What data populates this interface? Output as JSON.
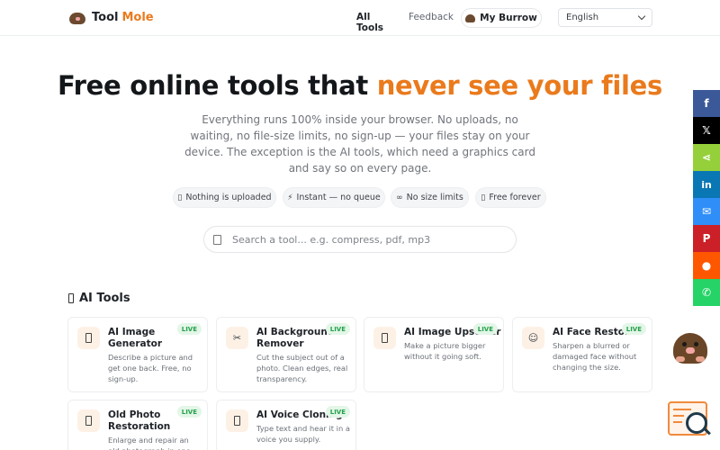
{
  "header": {
    "logo_word1": "Tool",
    "logo_word2": "Mole",
    "nav_all_tools": "All Tools",
    "nav_feedback": "Feedback",
    "burrow_label": "My Burrow",
    "language": "English"
  },
  "hero": {
    "title_main": "Free online tools that ",
    "title_accent": "never see your files",
    "subtitle": "Everything runs 100% inside your browser. No uploads, no waiting, no file-size limits, no sign-up — your files stay on your device. The exception is the AI tools, which need a graphics card and say so on every page.",
    "pills": [
      {
        "icon": "▯",
        "label": "Nothing is uploaded"
      },
      {
        "icon": "⚡",
        "label": "Instant — no queue"
      },
      {
        "icon": "∞",
        "label": "No size limits"
      },
      {
        "icon": "▯",
        "label": "Free forever"
      }
    ]
  },
  "search": {
    "placeholder": "Search a tool... e.g. compress, pdf, mp3"
  },
  "section": {
    "title": "AI Tools"
  },
  "cards": [
    {
      "title": "AI Image Generator",
      "desc": "Describe a picture and get one back. Free, no sign-up.",
      "badge": "LIVE",
      "icon": "▯"
    },
    {
      "title": "AI Background Remover",
      "desc": "Cut the subject out of a photo. Clean edges, real transparency.",
      "badge": "LIVE",
      "icon": "✂"
    },
    {
      "title": "AI Image Upscaler",
      "desc": "Make a picture bigger without it going soft.",
      "badge": "LIVE",
      "icon": "▯"
    },
    {
      "title": "AI Face Restorer",
      "desc": "Sharpen a blurred or damaged face without changing the size.",
      "badge": "LIVE",
      "icon": "☺"
    },
    {
      "title": "Old Photo Restoration",
      "desc": "Enlarge and repair an old photograph in one",
      "badge": "LIVE",
      "icon": "▯"
    },
    {
      "title": "AI Voice Cloning",
      "desc": "Type text and hear it in a voice you supply.",
      "badge": "LIVE",
      "icon": "▯"
    }
  ],
  "share": [
    {
      "name": "facebook",
      "glyph": "f",
      "color": "#3b5998"
    },
    {
      "name": "x",
      "glyph": "𝕏",
      "color": "#000000"
    },
    {
      "name": "sharethis",
      "glyph": "⋖",
      "color": "#95d03a"
    },
    {
      "name": "linkedin",
      "glyph": "in",
      "color": "#0a77b5"
    },
    {
      "name": "messenger",
      "glyph": "✉",
      "color": "#2f8ef8"
    },
    {
      "name": "pinterest",
      "glyph": "P",
      "color": "#cb2027"
    },
    {
      "name": "reddit",
      "glyph": "●",
      "color": "#ff5700"
    },
    {
      "name": "whatsapp",
      "glyph": "✆",
      "color": "#25d366"
    }
  ]
}
